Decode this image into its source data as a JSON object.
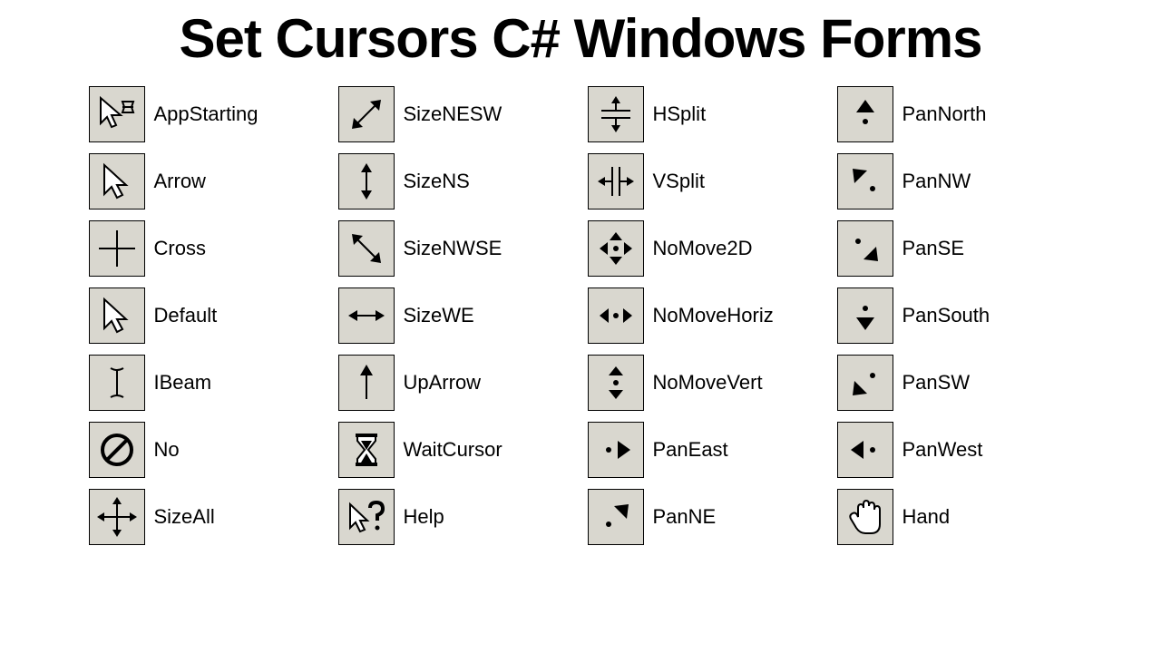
{
  "title": "Set Cursors C# Windows Forms",
  "columns": [
    [
      {
        "icon": "appstarting",
        "label": "AppStarting"
      },
      {
        "icon": "arrow",
        "label": "Arrow"
      },
      {
        "icon": "cross",
        "label": "Cross"
      },
      {
        "icon": "default",
        "label": "Default"
      },
      {
        "icon": "ibeam",
        "label": "IBeam"
      },
      {
        "icon": "no",
        "label": "No"
      },
      {
        "icon": "sizeall",
        "label": "SizeAll"
      }
    ],
    [
      {
        "icon": "sizenesw",
        "label": "SizeNESW"
      },
      {
        "icon": "sizens",
        "label": "SizeNS"
      },
      {
        "icon": "sizenwse",
        "label": "SizeNWSE"
      },
      {
        "icon": "sizewe",
        "label": "SizeWE"
      },
      {
        "icon": "uparrow",
        "label": "UpArrow"
      },
      {
        "icon": "waitcursor",
        "label": "WaitCursor"
      },
      {
        "icon": "help",
        "label": "Help"
      }
    ],
    [
      {
        "icon": "hsplit",
        "label": "HSplit"
      },
      {
        "icon": "vsplit",
        "label": "VSplit"
      },
      {
        "icon": "nomove2d",
        "label": "NoMove2D"
      },
      {
        "icon": "nomovehoriz",
        "label": "NoMoveHoriz"
      },
      {
        "icon": "nomovevert",
        "label": "NoMoveVert"
      },
      {
        "icon": "paneast",
        "label": "PanEast"
      },
      {
        "icon": "panne",
        "label": "PanNE"
      }
    ],
    [
      {
        "icon": "pannorth",
        "label": "PanNorth"
      },
      {
        "icon": "pannw",
        "label": "PanNW"
      },
      {
        "icon": "panse",
        "label": "PanSE"
      },
      {
        "icon": "pansouth",
        "label": "PanSouth"
      },
      {
        "icon": "pansw",
        "label": "PanSW"
      },
      {
        "icon": "panwest",
        "label": "PanWest"
      },
      {
        "icon": "hand",
        "label": "Hand"
      }
    ]
  ]
}
